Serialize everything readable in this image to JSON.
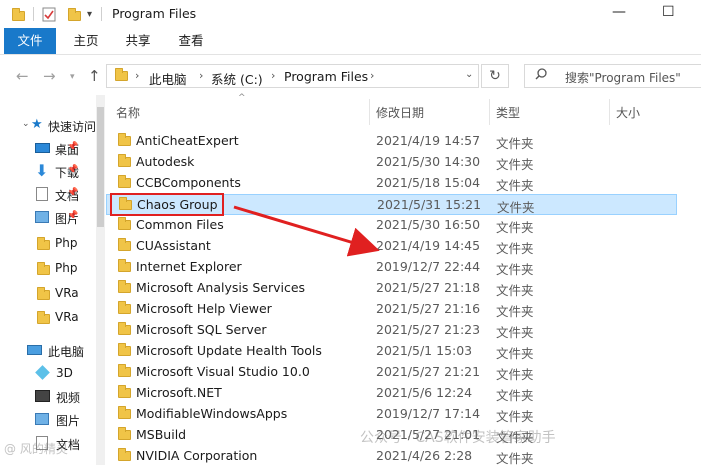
{
  "window": {
    "title": "Program Files",
    "minimize_glyph": "—",
    "maximize_glyph": "☐"
  },
  "ribbon": {
    "tabs": [
      {
        "label": "文件",
        "active": true
      },
      {
        "label": "主页"
      },
      {
        "label": "共享"
      },
      {
        "label": "查看"
      }
    ]
  },
  "address": {
    "crumbs": [
      "此电脑",
      "系统 (C:)",
      "Program Files"
    ],
    "search_placeholder": "搜索\"Program Files\""
  },
  "nav": {
    "quick_access": "快速访问",
    "items": [
      {
        "label": "桌面",
        "icon": "desktop-icon",
        "pinned": true
      },
      {
        "label": "下载",
        "icon": "download-icon",
        "pinned": true
      },
      {
        "label": "文档",
        "icon": "document-icon",
        "pinned": true
      },
      {
        "label": "图片",
        "icon": "pictures-icon",
        "pinned": true
      },
      {
        "label": "Php",
        "icon": "folder-icon"
      },
      {
        "label": "Php",
        "icon": "folder-icon"
      },
      {
        "label": "VRa",
        "icon": "folder-icon"
      },
      {
        "label": "VRa",
        "icon": "folder-icon"
      }
    ],
    "this_pc": "此电脑",
    "pc_items": [
      {
        "label": "3D",
        "icon": "3d-objects-icon"
      },
      {
        "label": "视频",
        "icon": "video-icon"
      },
      {
        "label": "图片",
        "icon": "pictures-icon"
      },
      {
        "label": "文档",
        "icon": "document-icon"
      }
    ]
  },
  "columns": {
    "name": "名称",
    "date": "修改日期",
    "type": "类型",
    "size": "大小"
  },
  "files": [
    {
      "name": "AntiCheatExpert",
      "date": "2021/4/19 14:57",
      "type": "文件夹"
    },
    {
      "name": "Autodesk",
      "date": "2021/5/30 14:30",
      "type": "文件夹"
    },
    {
      "name": "CCBComponents",
      "date": "2021/5/18 15:04",
      "type": "文件夹"
    },
    {
      "name": "Chaos Group",
      "date": "2021/5/31 15:21",
      "type": "文件夹",
      "selected": true
    },
    {
      "name": "Common Files",
      "date": "2021/5/30 16:50",
      "type": "文件夹"
    },
    {
      "name": "CUAssistant",
      "date": "2021/4/19 14:45",
      "type": "文件夹"
    },
    {
      "name": "Internet Explorer",
      "date": "2019/12/7 22:44",
      "type": "文件夹"
    },
    {
      "name": "Microsoft Analysis Services",
      "date": "2021/5/27 21:18",
      "type": "文件夹"
    },
    {
      "name": "Microsoft Help Viewer",
      "date": "2021/5/27 21:16",
      "type": "文件夹"
    },
    {
      "name": "Microsoft SQL Server",
      "date": "2021/5/27 21:23",
      "type": "文件夹"
    },
    {
      "name": "Microsoft Update Health Tools",
      "date": "2021/5/1 15:03",
      "type": "文件夹"
    },
    {
      "name": "Microsoft Visual Studio 10.0",
      "date": "2021/5/27 21:21",
      "type": "文件夹"
    },
    {
      "name": "Microsoft.NET",
      "date": "2021/5/6 12:24",
      "type": "文件夹"
    },
    {
      "name": "ModifiableWindowsApps",
      "date": "2019/12/7 17:14",
      "type": "文件夹"
    },
    {
      "name": "MSBuild",
      "date": "2021/5/27 21:01",
      "type": "文件夹"
    },
    {
      "name": "NVIDIA Corporation",
      "date": "2021/4/26 2:28",
      "type": "文件夹"
    }
  ],
  "watermark": {
    "main": "公众号 · CAS软件安装管家助手",
    "corner": "@ 风的精灵"
  },
  "colors": {
    "accent": "#1979ca",
    "selection": "#cce8ff",
    "highlight": "#e02020",
    "folder": "#f0c447"
  }
}
